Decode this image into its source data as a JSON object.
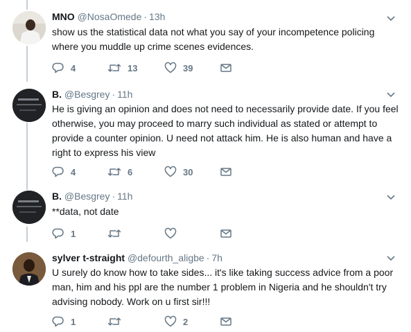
{
  "tweets": [
    {
      "name": "MNO",
      "handle": "@NosaOmede",
      "time": "13h",
      "lines": [
        "show us the statistical data not what you say of your incompetence policing",
        "where you muddle up crime scenes evidences."
      ],
      "replies": "4",
      "retweets": "13",
      "likes": "39"
    },
    {
      "name": "B.",
      "handle": "@Besgrey",
      "time": "11h",
      "lines": [
        "He is giving an opinion and does not need to necessarily provide date. If you feel",
        "otherwise, you may proceed to marry such individual as stated or attempt to",
        "provide a counter opinion. U need not attack him. He is also human and have a",
        "right to express his view"
      ],
      "replies": "4",
      "retweets": "6",
      "likes": "30"
    },
    {
      "name": "B.",
      "handle": "@Besgrey",
      "time": "11h",
      "lines": [
        "**data, not date"
      ],
      "replies": "1",
      "retweets": "",
      "likes": ""
    },
    {
      "name": "sylver t-straight",
      "handle": "@defourth_aligbe",
      "time": "7h",
      "lines": [
        "U surely do know how to take sides... it's like taking success advice from a poor",
        "man, him and his ppl are the number 1 problem in Nigeria and he shouldn't try",
        "advising nobody. Work on u first sir!!!"
      ],
      "replies": "1",
      "retweets": "",
      "likes": "2"
    }
  ],
  "separator": "·",
  "colors": {
    "text": "#14171a",
    "muted": "#657786",
    "thread_line": "#c4cfd6",
    "icon": "#657786"
  },
  "icons": {
    "reply": "reply-icon",
    "retweet": "retweet-icon",
    "like": "heart-icon",
    "message": "envelope-icon",
    "menu": "chevron-down-icon"
  }
}
